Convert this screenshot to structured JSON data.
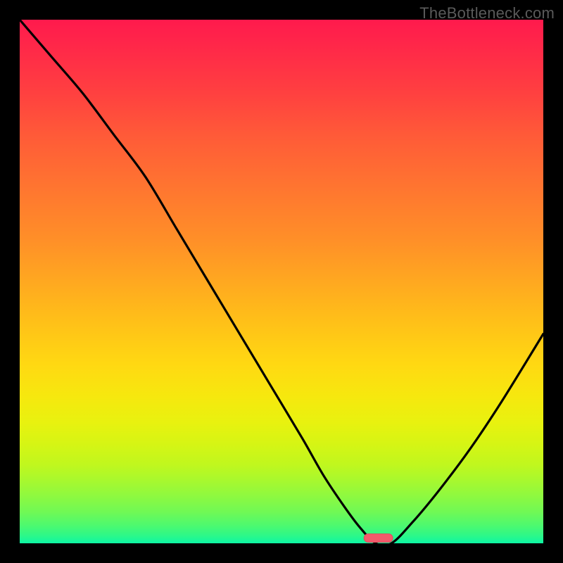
{
  "watermark": "TheBottleneck.com",
  "colors": {
    "frame": "#000000",
    "curve": "#000000",
    "marker_fill": "#f25a6b",
    "marker_stroke": "#e14a5b",
    "gradient_top": "#ff1a4d",
    "gradient_bottom": "#0df6a4"
  },
  "chart_data": {
    "type": "line",
    "title": "",
    "xlabel": "",
    "ylabel": "",
    "xlim": [
      0,
      100
    ],
    "ylim": [
      0,
      100
    ],
    "grid": false,
    "legend": false,
    "note": "V-shaped curve against a vertical red→green gradient. x is horizontal position as % of plot width (0=left, 100=right). y is vertical position as % of plot height measured from the BOTTOM (0=bottom edge, 100=top edge). Values estimated from pixels; axes are unlabeled in the image.",
    "series": [
      {
        "name": "bottleneck-curve",
        "x": [
          0,
          6,
          12,
          18,
          24,
          30,
          36,
          42,
          48,
          54,
          58,
          62,
          65,
          68,
          71,
          75,
          80,
          86,
          92,
          100
        ],
        "y": [
          100,
          93,
          86,
          78,
          70,
          60,
          50,
          40,
          30,
          20,
          13,
          7,
          3,
          0,
          0,
          4,
          10,
          18,
          27,
          40
        ]
      }
    ],
    "marker": {
      "name": "highlight-pill",
      "x_center_pct": 68.5,
      "y_from_bottom_pct": 1.0,
      "width_pct": 5.5,
      "height_pct": 1.6,
      "shape": "pill"
    }
  }
}
